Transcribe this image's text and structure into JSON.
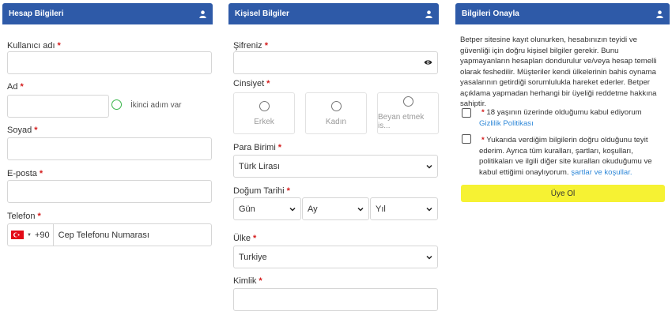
{
  "colors": {
    "header_bg": "#2e5aa8",
    "required": "#d41c1c",
    "link": "#2f88d8",
    "submit_bg": "#f6f233",
    "success": "#39b54a"
  },
  "account": {
    "title": "Hesap Bilgileri",
    "icon": "user-icon",
    "username_label": "Kullanıcı adı",
    "name_label": "Ad",
    "name_hint": "İkinci adım var",
    "surname_label": "Soyad",
    "email_label": "E-posta",
    "phone_label": "Telefon",
    "phone_code": "+90",
    "phone_placeholder": "Cep Telefonu Numarası",
    "required_mark": "*"
  },
  "personal": {
    "title": "Kişisel Bilgiler",
    "icon": "user-icon",
    "password_label": "Şifreniz",
    "gender_label": "Cinsiyet",
    "gender_options": [
      "Erkek",
      "Kadın",
      "Beyan etmek is..."
    ],
    "currency_label": "Para Birimi",
    "currency_value": "Türk Lirası",
    "birth_label": "Doğum Tarihi",
    "birth_day": "Gün",
    "birth_month": "Ay",
    "birth_year": "Yıl",
    "country_label": "Ülke",
    "country_value": "Turkiye",
    "id_label": "Kimlik",
    "required_mark": "*"
  },
  "confirm": {
    "title": "Bilgileri Onayla",
    "icon": "user-icon",
    "info_text": "Betper sitesine kayıt olunurken, hesabınızın teyidi ve güvenliği için doğru kişisel bilgiler gerekir. Bunu yapmayanların hesapları dondurulur ve/veya hesap temelli olarak feshedilir. Müşteriler kendi ülkelerinin bahis oynama yasalarının getirdiği sorumlulukla hareket ederler. Betper açıklama yapmadan herhangi bir üyeliği reddetme hakkına sahiptir.",
    "age_text": "18 yaşının üzerinde olduğumu kabul ediyorum",
    "age_link": "Gizlilik Politikası",
    "terms_text": "Yukarıda verdiğim bilgilerin doğru olduğunu teyit ederim. Ayrıca tüm kuralları, şartları, koşulları, politikaları ve ilgili diğer site kuralları okuduğumu ve kabul ettiğimi onaylıyorum.",
    "terms_link": "şartlar ve koşullar.",
    "submit_label": "Üye Ol",
    "required_mark": "*"
  }
}
